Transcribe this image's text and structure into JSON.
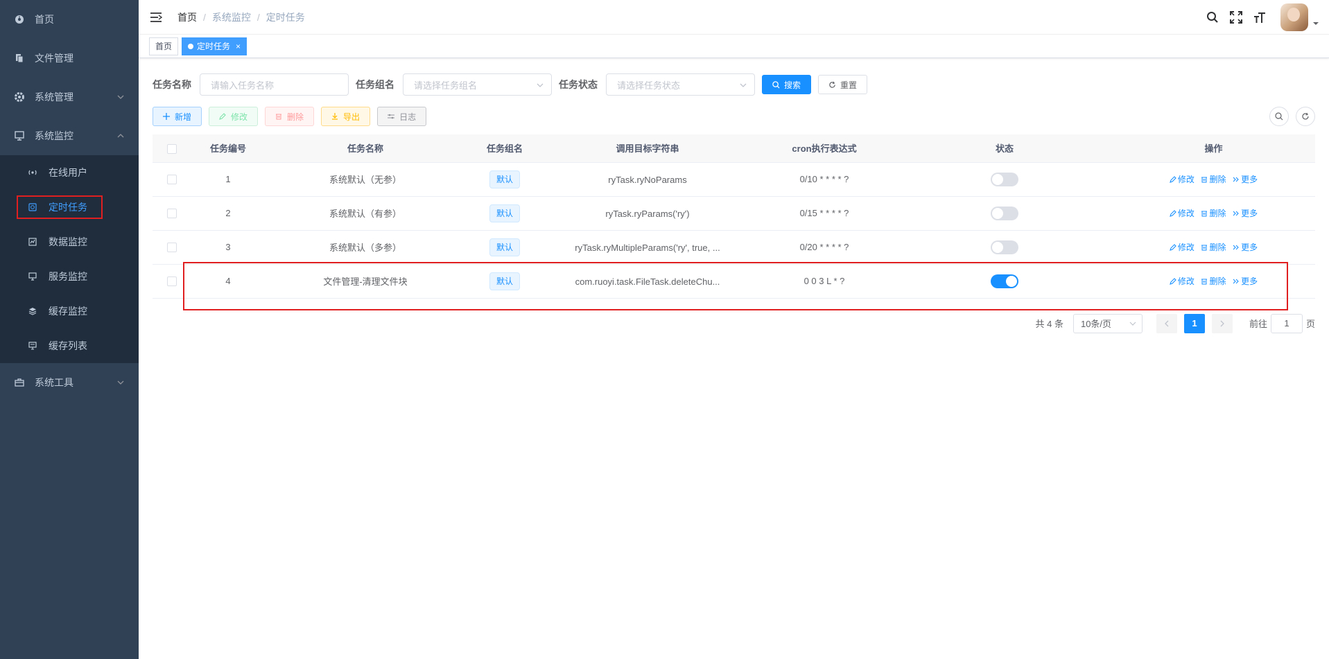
{
  "sidebar": {
    "items": [
      {
        "label": "首页",
        "icon": "dashboard-icon"
      },
      {
        "label": "文件管理",
        "icon": "file-icon"
      },
      {
        "label": "系统管理",
        "icon": "gear-icon"
      },
      {
        "label": "系统监控",
        "icon": "monitor-icon"
      }
    ],
    "monitor_sub": [
      {
        "label": "在线用户",
        "icon": "online-icon"
      },
      {
        "label": "定时任务",
        "icon": "job-icon"
      },
      {
        "label": "数据监控",
        "icon": "druid-icon"
      },
      {
        "label": "服务监控",
        "icon": "server-icon"
      },
      {
        "label": "缓存监控",
        "icon": "redis-icon"
      },
      {
        "label": "缓存列表",
        "icon": "redis-list-icon"
      }
    ],
    "tools": {
      "label": "系统工具",
      "icon": "tool-icon"
    }
  },
  "breadcrumb": [
    "首页",
    "系统监控",
    "定时任务"
  ],
  "tags": [
    {
      "label": "首页"
    },
    {
      "label": "定时任务",
      "close": "×"
    }
  ],
  "search": {
    "job_name_label": "任务名称",
    "job_name_placeholder": "请输入任务名称",
    "job_group_label": "任务组名",
    "job_group_placeholder": "请选择任务组名",
    "status_label": "任务状态",
    "status_placeholder": "请选择任务状态",
    "search_btn": "搜索",
    "reset_btn": "重置"
  },
  "toolbar": {
    "add": "新增",
    "edit": "修改",
    "delete": "删除",
    "export": "导出",
    "log": "日志"
  },
  "table": {
    "headers": [
      "任务编号",
      "任务名称",
      "任务组名",
      "调用目标字符串",
      "cron执行表达式",
      "状态",
      "操作"
    ],
    "rows": [
      {
        "id": "1",
        "name": "系统默认（无参）",
        "group": "默认",
        "target": "ryTask.ryNoParams",
        "cron": "0/10 * * * * ?",
        "status": "off"
      },
      {
        "id": "2",
        "name": "系统默认（有参）",
        "group": "默认",
        "target": "ryTask.ryParams('ry')",
        "cron": "0/15 * * * * ?",
        "status": "off"
      },
      {
        "id": "3",
        "name": "系统默认（多参）",
        "group": "默认",
        "target": "ryTask.ryMultipleParams('ry', true, ...",
        "cron": "0/20 * * * * ?",
        "status": "off"
      },
      {
        "id": "4",
        "name": "文件管理-清理文件块",
        "group": "默认",
        "target": "com.ruoyi.task.FileTask.deleteChu...",
        "cron": "0 0 3 L * ?",
        "status": "on"
      }
    ],
    "ops": {
      "edit": "修改",
      "delete": "删除",
      "more": "更多"
    }
  },
  "pagination": {
    "total": "共 4 条",
    "page_size": "10条/页",
    "current": "1",
    "goto_prefix": "前往",
    "goto_value": "1",
    "goto_suffix": "页"
  },
  "colors": {
    "primary": "#1890ff",
    "sidebar_bg": "#304156",
    "submenu_bg": "#1f2d3d",
    "highlight": "#e02020"
  }
}
